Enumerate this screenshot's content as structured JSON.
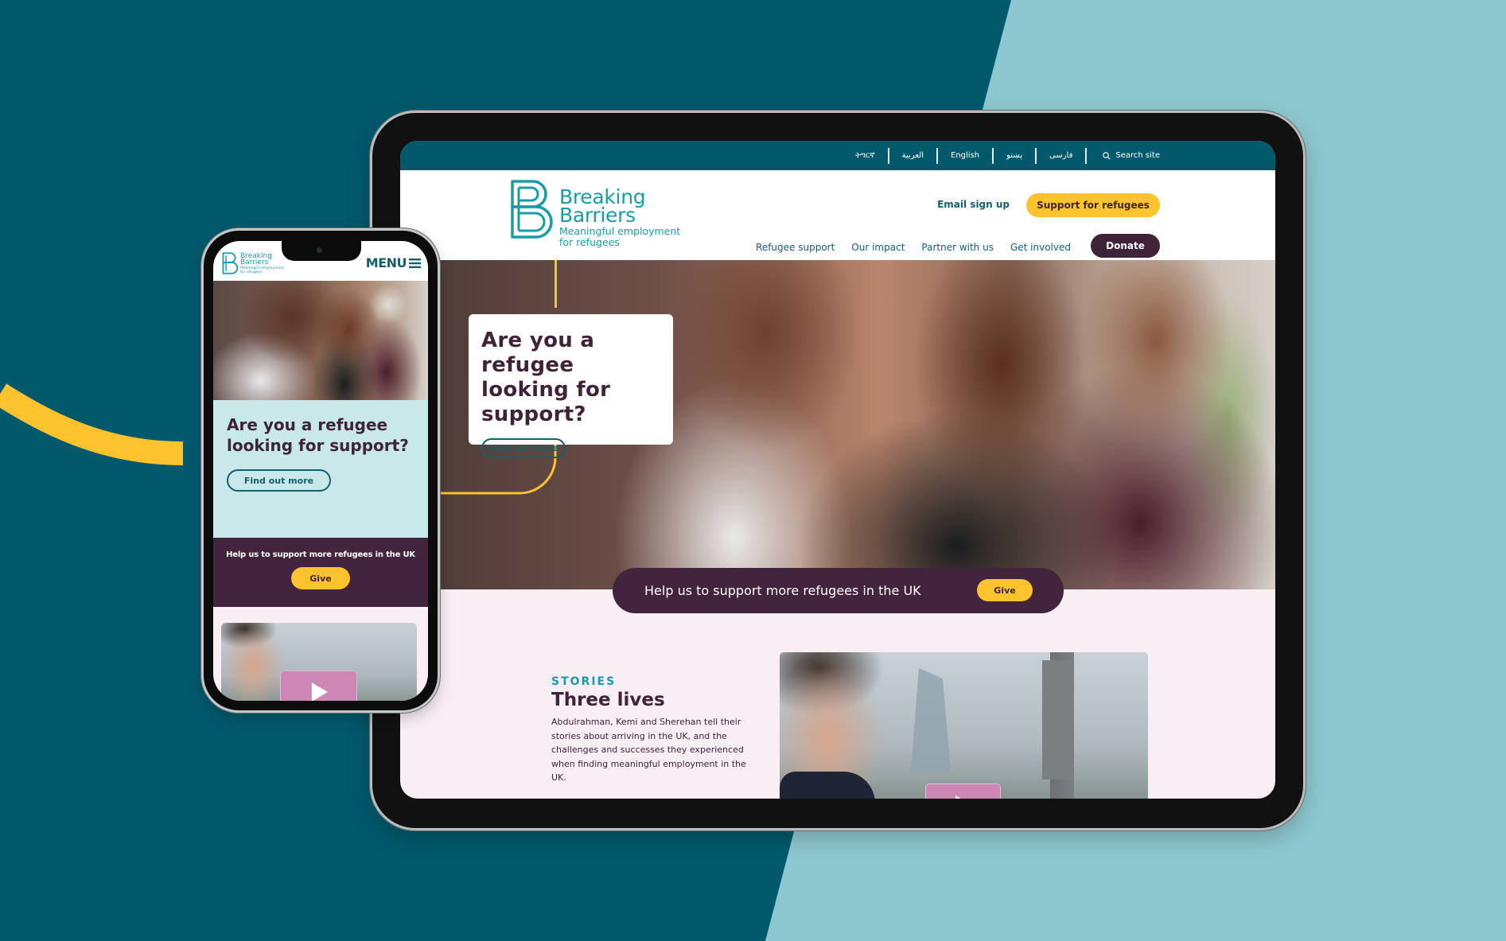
{
  "colors": {
    "bg_dark_teal": "#02596b",
    "bg_light_teal": "#8dc7cf",
    "brand_teal": "#1a9ca6",
    "nav_teal": "#16606e",
    "plum": "#42253d",
    "yellow": "#fdc32e",
    "pink_bg": "#f8eef4",
    "play_pink": "#cd87b4"
  },
  "tablet": {
    "top_bar": {
      "languages": [
        "ትግርኛ",
        "العربية",
        "English",
        "پښتو",
        "فارسی"
      ],
      "search_label": "Search site",
      "search_icon": "search-icon"
    },
    "header": {
      "logo": {
        "name_line1": "Breaking",
        "name_line2": "Barriers",
        "tagline_line1": "Meaningful employment",
        "tagline_line2": "for refugees"
      },
      "email_signup": "Email sign up",
      "support_button": "Support for refugees",
      "nav": [
        "Refugee support",
        "Our impact",
        "Partner with us",
        "Get involved"
      ],
      "donate_button": "Donate"
    },
    "hero": {
      "title": "Are you a refugee looking for support?",
      "cta": "Find out more"
    },
    "give_bar": {
      "text": "Help us to support more refugees in the UK",
      "button": "Give"
    },
    "stories": {
      "label": "STORIES",
      "title": "Three lives",
      "body": "Abdulrahman, Kemi and Sherehan tell their stories about arriving in the UK, and the challenges and successes they experienced when finding meaningful employment in the UK.",
      "video_icon": "play-icon"
    }
  },
  "phone": {
    "logo": {
      "name_line1": "Breaking",
      "name_line2": "Barriers",
      "tagline_line1": "Meaningful employment",
      "tagline_line2": "for refugees"
    },
    "menu_label": "MENU",
    "hero": {
      "title": "Are you a refugee looking for support?",
      "cta": "Find out more"
    },
    "give_bar": {
      "text": "Help us to support more refugees in the UK",
      "button": "Give"
    }
  }
}
